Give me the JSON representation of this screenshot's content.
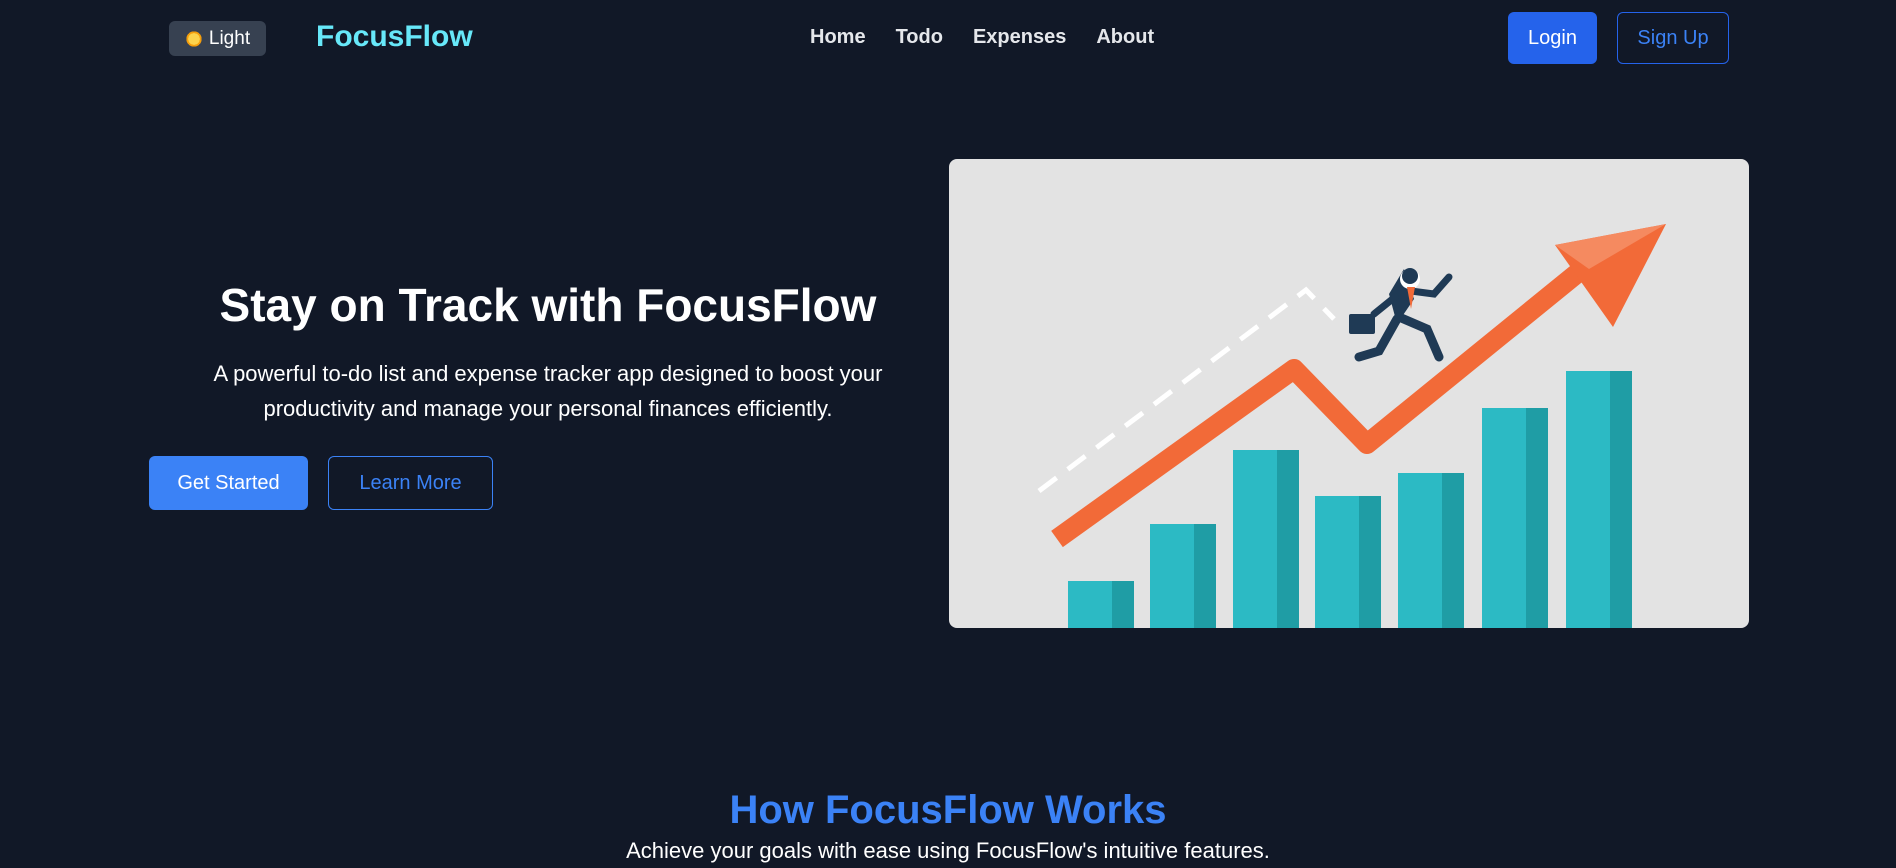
{
  "nav": {
    "theme_label": "Light",
    "theme_icon": "sun-icon",
    "brand": "FocusFlow",
    "links": [
      "Home",
      "Todo",
      "Expenses",
      "About"
    ],
    "login": "Login",
    "signup": "Sign Up"
  },
  "hero": {
    "title": "Stay on Track with FocusFlow",
    "subtitle": "A powerful to-do list and expense tracker app designed to boost your productivity and manage your personal finances efficiently.",
    "primary_cta": "Get Started",
    "secondary_cta": "Learn More"
  },
  "how_it_works": {
    "title": "How FocusFlow Works",
    "subtitle": "Achieve your goals with ease using FocusFlow's intuitive features."
  },
  "colors": {
    "background": "#111827",
    "brand": "#67e8f9",
    "accent": "#3b82f6",
    "primary_button": "#2563eb",
    "illustration_bars": "#2cbac4",
    "illustration_arrow": "#f26a38"
  }
}
